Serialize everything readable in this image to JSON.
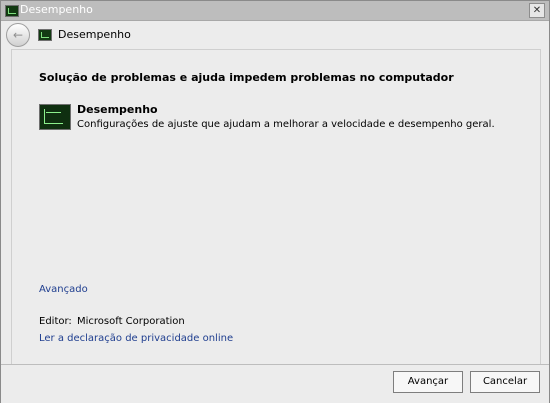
{
  "window": {
    "title": "Desempenho",
    "close_label": "✕"
  },
  "nav": {
    "title": "Desempenho",
    "back_icon": "back-arrow-icon"
  },
  "main": {
    "heading": "Solução de problemas e ajuda impedem problemas no computador",
    "item": {
      "title": "Desempenho",
      "description": "Configurações de ajuste que ajudam a melhorar a velocidade e desempenho geral."
    },
    "advanced_link": "Avançado",
    "editor_label": "Editor:",
    "editor_value": "Microsoft Corporation",
    "privacy_link": "Ler a declaração de privacidade online"
  },
  "footer": {
    "next_label": "Avançar",
    "cancel_label": "Cancelar"
  }
}
